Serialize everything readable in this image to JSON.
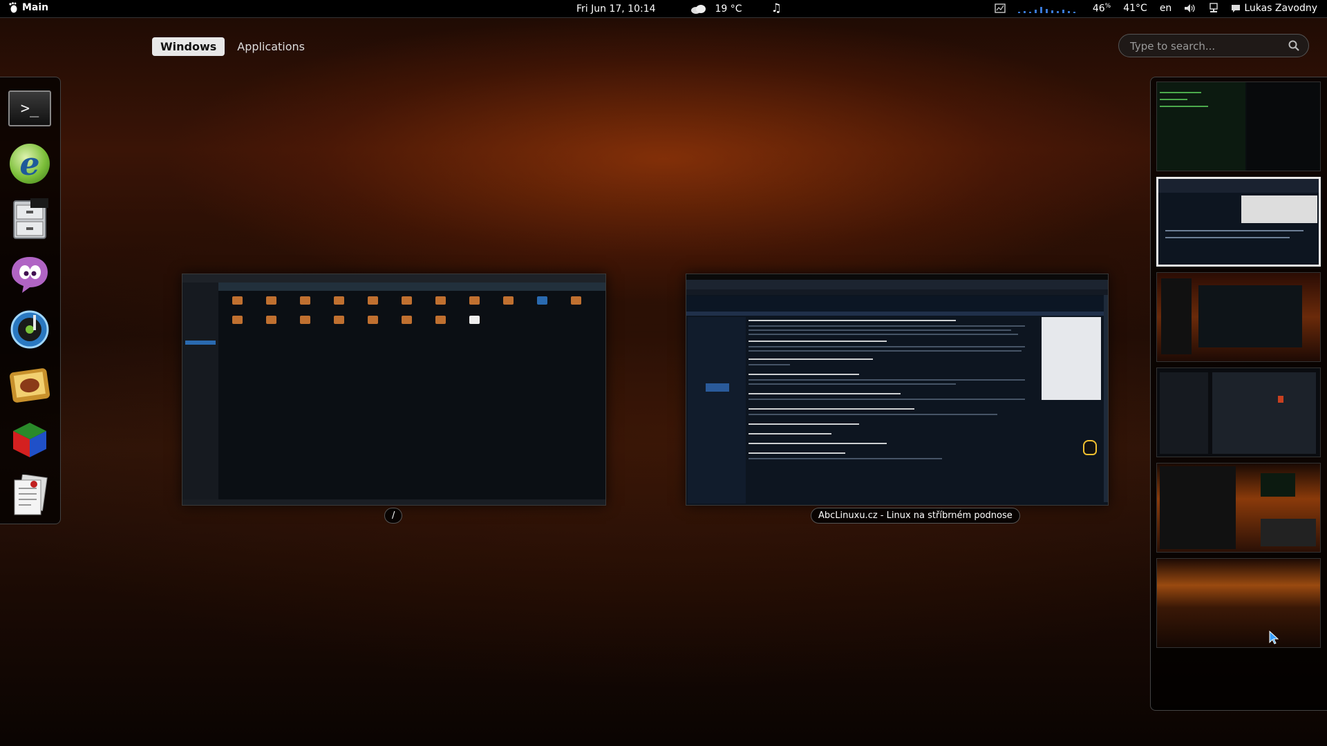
{
  "topbar": {
    "activities_label": "Main",
    "clock": "Fri Jun 17, 10:14",
    "weather_temp": "19 °C",
    "cpu_percent": "46",
    "cpu_unit": "%",
    "temperature": "41°C",
    "keyboard_layout": "en",
    "user_name": "Lukas Zavodny",
    "icons": [
      "gnome-foot-icon",
      "cloud-icon",
      "music-note-icon",
      "system-monitor-icon",
      "volume-icon",
      "network-icon",
      "chat-icon"
    ]
  },
  "overview": {
    "tabs": [
      {
        "label": "Windows",
        "active": true
      },
      {
        "label": "Applications",
        "active": false
      }
    ],
    "search": {
      "placeholder": "Type to search..."
    }
  },
  "dash": {
    "apps": [
      {
        "name": "terminal",
        "glyph": ">_"
      },
      {
        "name": "epiphany-browser",
        "glyph": "e"
      },
      {
        "name": "file-manager",
        "glyph": ""
      },
      {
        "name": "empathy-chat",
        "glyph": ""
      },
      {
        "name": "music-player",
        "glyph": "♪"
      },
      {
        "name": "photo-viewer",
        "glyph": ""
      },
      {
        "name": "3d-cube-app",
        "glyph": ""
      },
      {
        "name": "documents-app",
        "glyph": ""
      }
    ]
  },
  "windows": [
    {
      "id": "file-manager-window",
      "caption": "/"
    },
    {
      "id": "browser-window",
      "caption": "AbcLinuxu.cz - Linux na stříbrném podnose"
    }
  ],
  "workspaces": {
    "count": 6,
    "active_index": 1
  }
}
